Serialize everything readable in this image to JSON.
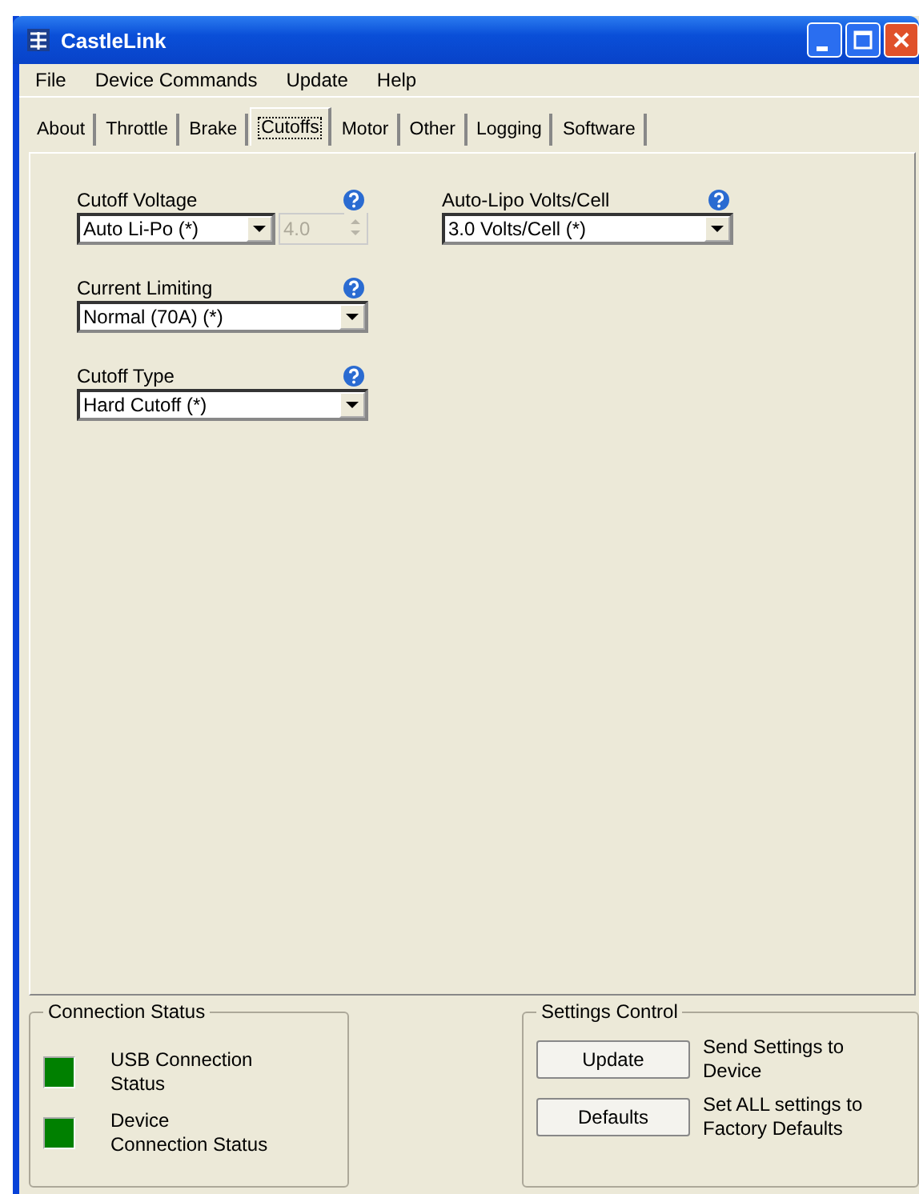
{
  "window": {
    "title": "CastleLink"
  },
  "menu": [
    "File",
    "Device Commands",
    "Update",
    "Help"
  ],
  "tabs": [
    {
      "label": "About",
      "selected": false
    },
    {
      "label": "Throttle",
      "selected": false
    },
    {
      "label": "Brake",
      "selected": false
    },
    {
      "label": "Cutoffs",
      "selected": true
    },
    {
      "label": "Motor",
      "selected": false
    },
    {
      "label": "Other",
      "selected": false
    },
    {
      "label": "Logging",
      "selected": false
    },
    {
      "label": "Software",
      "selected": false
    }
  ],
  "settings": [
    {
      "label": "Cutoff Voltage",
      "value": "Auto Li-Po (*)",
      "spin": {
        "value": "4.0",
        "disabled": true
      }
    },
    {
      "label": "Auto-Lipo Volts/Cell",
      "value": "3.0 Volts/Cell (*)"
    },
    {
      "label": "Current Limiting",
      "value": "Normal (70A) (*)"
    },
    {
      "label": "Cutoff Type",
      "value": "Hard Cutoff (*)"
    }
  ],
  "connection_status": {
    "title": "Connection Status",
    "items": [
      {
        "label": "USB Connection Status",
        "color": "#008000"
      },
      {
        "label": "Device Connection Status",
        "color": "#008000"
      }
    ]
  },
  "settings_control": {
    "title": "Settings Control",
    "items": [
      {
        "button": "Update",
        "description": "Send Settings to Device"
      },
      {
        "button": "Defaults",
        "description": "Set ALL settings to Factory Defaults"
      }
    ]
  }
}
